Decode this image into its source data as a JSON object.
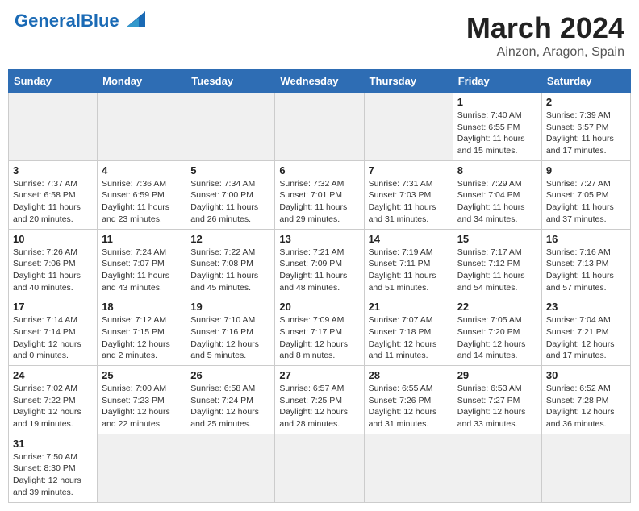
{
  "header": {
    "logo_general": "General",
    "logo_blue": "Blue",
    "main_title": "March 2024",
    "subtitle": "Ainzon, Aragon, Spain"
  },
  "calendar": {
    "days_of_week": [
      "Sunday",
      "Monday",
      "Tuesday",
      "Wednesday",
      "Thursday",
      "Friday",
      "Saturday"
    ],
    "weeks": [
      [
        {
          "day": "",
          "info": "",
          "empty": true
        },
        {
          "day": "",
          "info": "",
          "empty": true
        },
        {
          "day": "",
          "info": "",
          "empty": true
        },
        {
          "day": "",
          "info": "",
          "empty": true
        },
        {
          "day": "",
          "info": "",
          "empty": true
        },
        {
          "day": "1",
          "info": "Sunrise: 7:40 AM\nSunset: 6:55 PM\nDaylight: 11 hours and 15 minutes."
        },
        {
          "day": "2",
          "info": "Sunrise: 7:39 AM\nSunset: 6:57 PM\nDaylight: 11 hours and 17 minutes."
        }
      ],
      [
        {
          "day": "3",
          "info": "Sunrise: 7:37 AM\nSunset: 6:58 PM\nDaylight: 11 hours and 20 minutes."
        },
        {
          "day": "4",
          "info": "Sunrise: 7:36 AM\nSunset: 6:59 PM\nDaylight: 11 hours and 23 minutes."
        },
        {
          "day": "5",
          "info": "Sunrise: 7:34 AM\nSunset: 7:00 PM\nDaylight: 11 hours and 26 minutes."
        },
        {
          "day": "6",
          "info": "Sunrise: 7:32 AM\nSunset: 7:01 PM\nDaylight: 11 hours and 29 minutes."
        },
        {
          "day": "7",
          "info": "Sunrise: 7:31 AM\nSunset: 7:03 PM\nDaylight: 11 hours and 31 minutes."
        },
        {
          "day": "8",
          "info": "Sunrise: 7:29 AM\nSunset: 7:04 PM\nDaylight: 11 hours and 34 minutes."
        },
        {
          "day": "9",
          "info": "Sunrise: 7:27 AM\nSunset: 7:05 PM\nDaylight: 11 hours and 37 minutes."
        }
      ],
      [
        {
          "day": "10",
          "info": "Sunrise: 7:26 AM\nSunset: 7:06 PM\nDaylight: 11 hours and 40 minutes."
        },
        {
          "day": "11",
          "info": "Sunrise: 7:24 AM\nSunset: 7:07 PM\nDaylight: 11 hours and 43 minutes."
        },
        {
          "day": "12",
          "info": "Sunrise: 7:22 AM\nSunset: 7:08 PM\nDaylight: 11 hours and 45 minutes."
        },
        {
          "day": "13",
          "info": "Sunrise: 7:21 AM\nSunset: 7:09 PM\nDaylight: 11 hours and 48 minutes."
        },
        {
          "day": "14",
          "info": "Sunrise: 7:19 AM\nSunset: 7:11 PM\nDaylight: 11 hours and 51 minutes."
        },
        {
          "day": "15",
          "info": "Sunrise: 7:17 AM\nSunset: 7:12 PM\nDaylight: 11 hours and 54 minutes."
        },
        {
          "day": "16",
          "info": "Sunrise: 7:16 AM\nSunset: 7:13 PM\nDaylight: 11 hours and 57 minutes."
        }
      ],
      [
        {
          "day": "17",
          "info": "Sunrise: 7:14 AM\nSunset: 7:14 PM\nDaylight: 12 hours and 0 minutes."
        },
        {
          "day": "18",
          "info": "Sunrise: 7:12 AM\nSunset: 7:15 PM\nDaylight: 12 hours and 2 minutes."
        },
        {
          "day": "19",
          "info": "Sunrise: 7:10 AM\nSunset: 7:16 PM\nDaylight: 12 hours and 5 minutes."
        },
        {
          "day": "20",
          "info": "Sunrise: 7:09 AM\nSunset: 7:17 PM\nDaylight: 12 hours and 8 minutes."
        },
        {
          "day": "21",
          "info": "Sunrise: 7:07 AM\nSunset: 7:18 PM\nDaylight: 12 hours and 11 minutes."
        },
        {
          "day": "22",
          "info": "Sunrise: 7:05 AM\nSunset: 7:20 PM\nDaylight: 12 hours and 14 minutes."
        },
        {
          "day": "23",
          "info": "Sunrise: 7:04 AM\nSunset: 7:21 PM\nDaylight: 12 hours and 17 minutes."
        }
      ],
      [
        {
          "day": "24",
          "info": "Sunrise: 7:02 AM\nSunset: 7:22 PM\nDaylight: 12 hours and 19 minutes."
        },
        {
          "day": "25",
          "info": "Sunrise: 7:00 AM\nSunset: 7:23 PM\nDaylight: 12 hours and 22 minutes."
        },
        {
          "day": "26",
          "info": "Sunrise: 6:58 AM\nSunset: 7:24 PM\nDaylight: 12 hours and 25 minutes."
        },
        {
          "day": "27",
          "info": "Sunrise: 6:57 AM\nSunset: 7:25 PM\nDaylight: 12 hours and 28 minutes."
        },
        {
          "day": "28",
          "info": "Sunrise: 6:55 AM\nSunset: 7:26 PM\nDaylight: 12 hours and 31 minutes."
        },
        {
          "day": "29",
          "info": "Sunrise: 6:53 AM\nSunset: 7:27 PM\nDaylight: 12 hours and 33 minutes."
        },
        {
          "day": "30",
          "info": "Sunrise: 6:52 AM\nSunset: 7:28 PM\nDaylight: 12 hours and 36 minutes."
        }
      ],
      [
        {
          "day": "31",
          "info": "Sunrise: 7:50 AM\nSunset: 8:30 PM\nDaylight: 12 hours and 39 minutes."
        },
        {
          "day": "",
          "info": "",
          "empty": true
        },
        {
          "day": "",
          "info": "",
          "empty": true
        },
        {
          "day": "",
          "info": "",
          "empty": true
        },
        {
          "day": "",
          "info": "",
          "empty": true
        },
        {
          "day": "",
          "info": "",
          "empty": true
        },
        {
          "day": "",
          "info": "",
          "empty": true
        }
      ]
    ]
  }
}
